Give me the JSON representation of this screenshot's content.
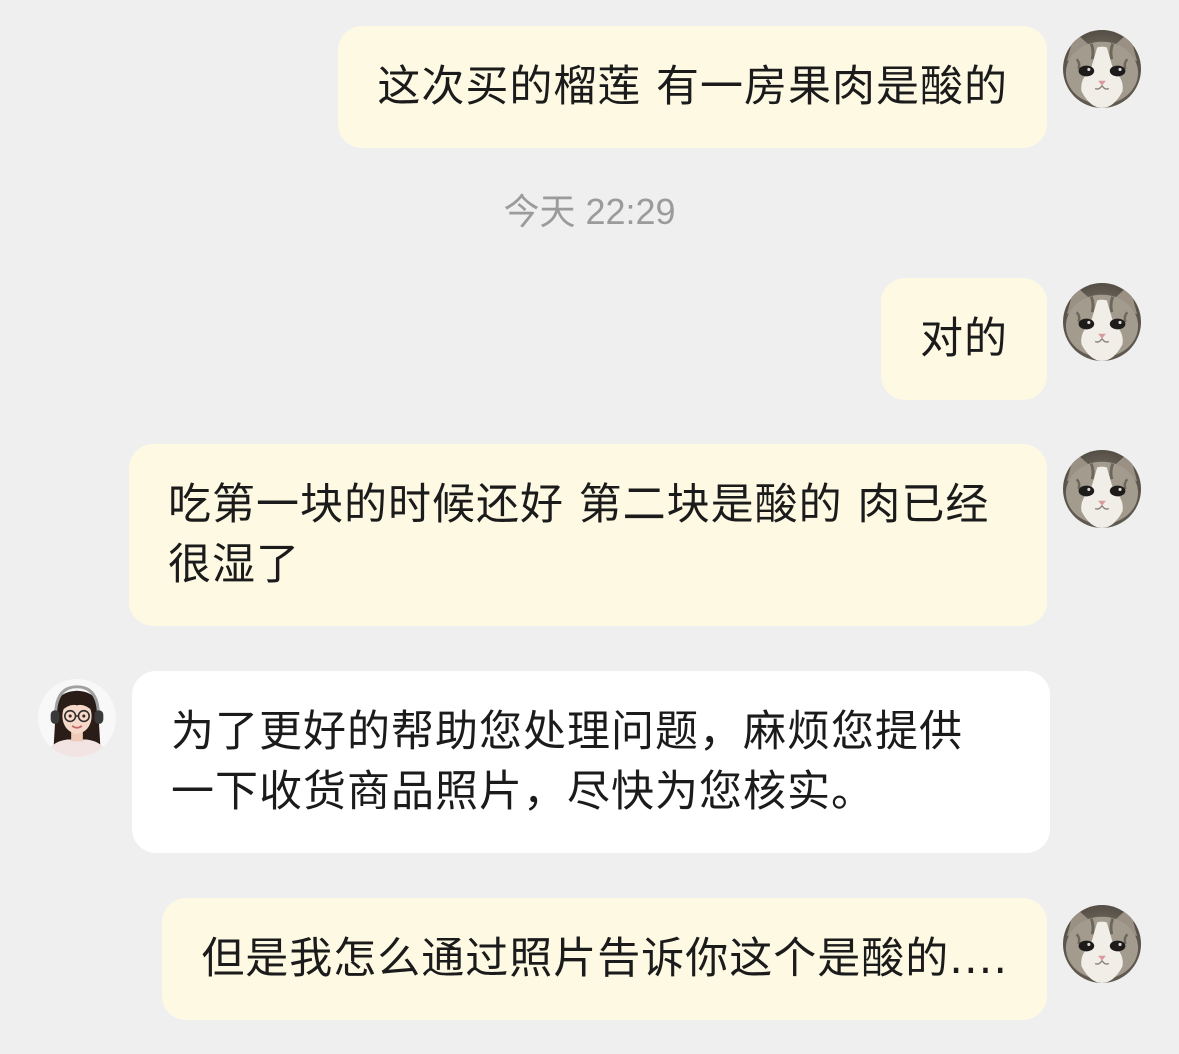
{
  "colors": {
    "background": "#efefef",
    "user_bubble": "#fdf9e3",
    "agent_bubble": "#ffffff",
    "text": "#1b1b1b",
    "timestamp": "#9b9b9b"
  },
  "timestamp": "今天 22:29",
  "messages": [
    {
      "avatar_icon": "cat-avatar-icon",
      "lines": [
        "这次买的榴莲 有一房果肉是酸的"
      ]
    },
    {
      "avatar_icon": "cat-avatar-icon",
      "lines": [
        "对的"
      ]
    },
    {
      "avatar_icon": "cat-avatar-icon",
      "lines": [
        "吃第一块的时候还好 第二块是酸的 肉已经",
        "很湿了"
      ]
    },
    {
      "avatar_icon": "agent-avatar-icon",
      "lines": [
        "为了更好的帮助您处理问题，麻烦您提供",
        "一下收货商品照片，尽快为您核实。"
      ]
    },
    {
      "avatar_icon": "cat-avatar-icon",
      "lines": [
        "但是我怎么通过照片告诉你这个是酸的...."
      ]
    }
  ]
}
